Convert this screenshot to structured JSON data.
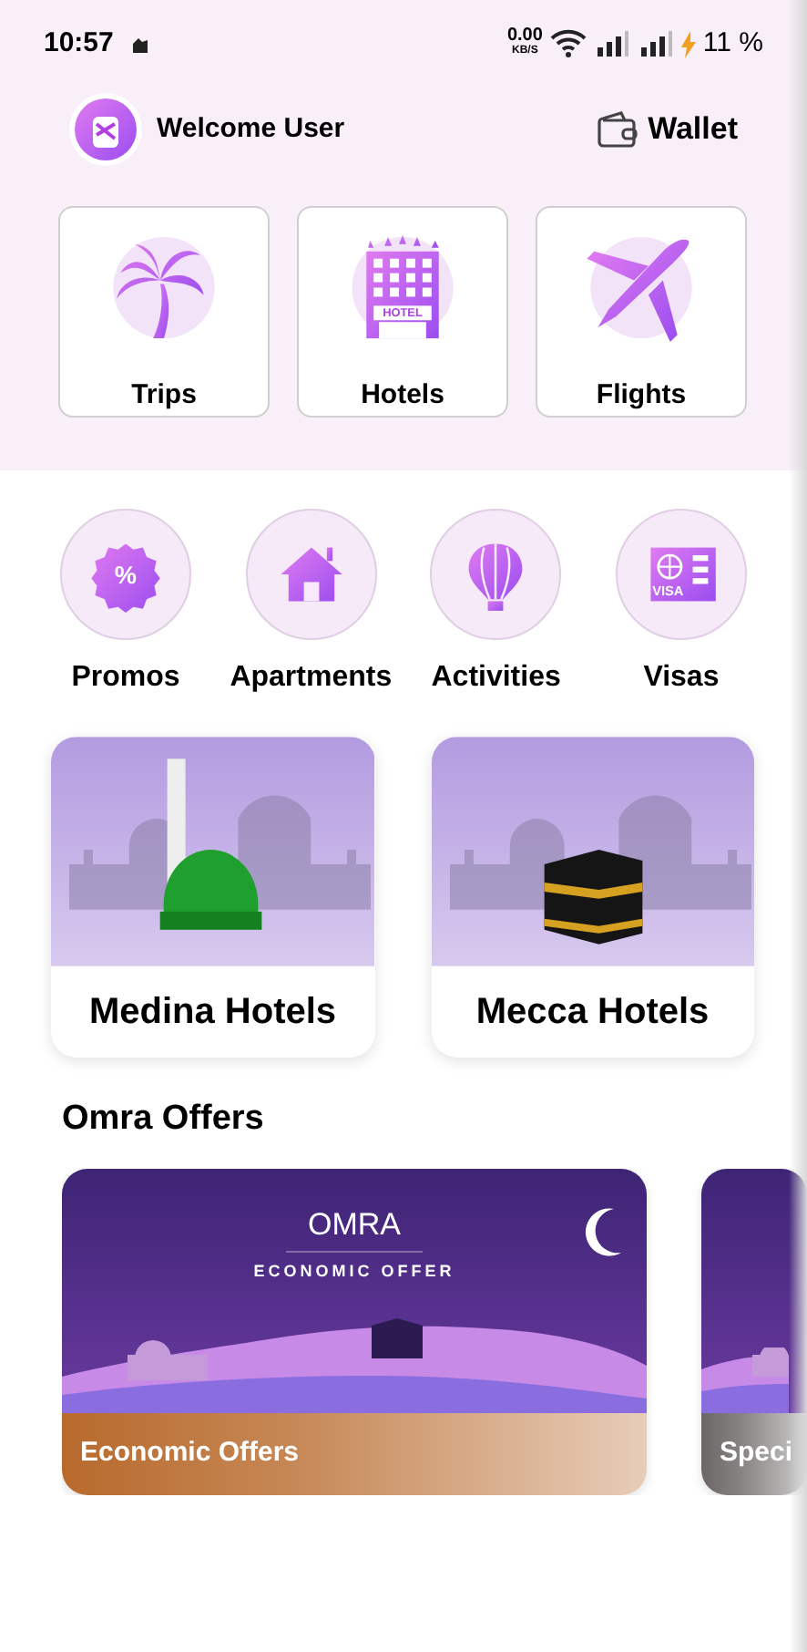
{
  "status_bar": {
    "time": "10:57",
    "net_speed": "0.00",
    "net_unit": "KB/S",
    "battery": "11 %"
  },
  "header": {
    "greeting": "Welcome User",
    "wallet": "Wallet"
  },
  "main_categories": [
    {
      "kind": "palm",
      "label": "Trips"
    },
    {
      "kind": "hotel",
      "label": "Hotels",
      "sign": "HOTEL"
    },
    {
      "kind": "plane",
      "label": "Flights"
    }
  ],
  "services": [
    {
      "kind": "promo",
      "label": "Promos",
      "glyph": "%"
    },
    {
      "kind": "house",
      "label": "Apartments"
    },
    {
      "kind": "balloon",
      "label": "Activities"
    },
    {
      "kind": "visa",
      "label": "Visas",
      "glyph": "VISA"
    }
  ],
  "hotel_cards": [
    {
      "kind": "dome",
      "label": "Medina Hotels"
    },
    {
      "kind": "kaaba",
      "label": "Mecca Hotels"
    }
  ],
  "offers_title": "Omra Offers",
  "offers": [
    {
      "title": "OMRA",
      "subtitle": "ECONOMIC OFFER",
      "label": "Economic Offers",
      "color": "#b86a2c"
    },
    {
      "label": "Speci",
      "color": "#6b6766"
    }
  ]
}
